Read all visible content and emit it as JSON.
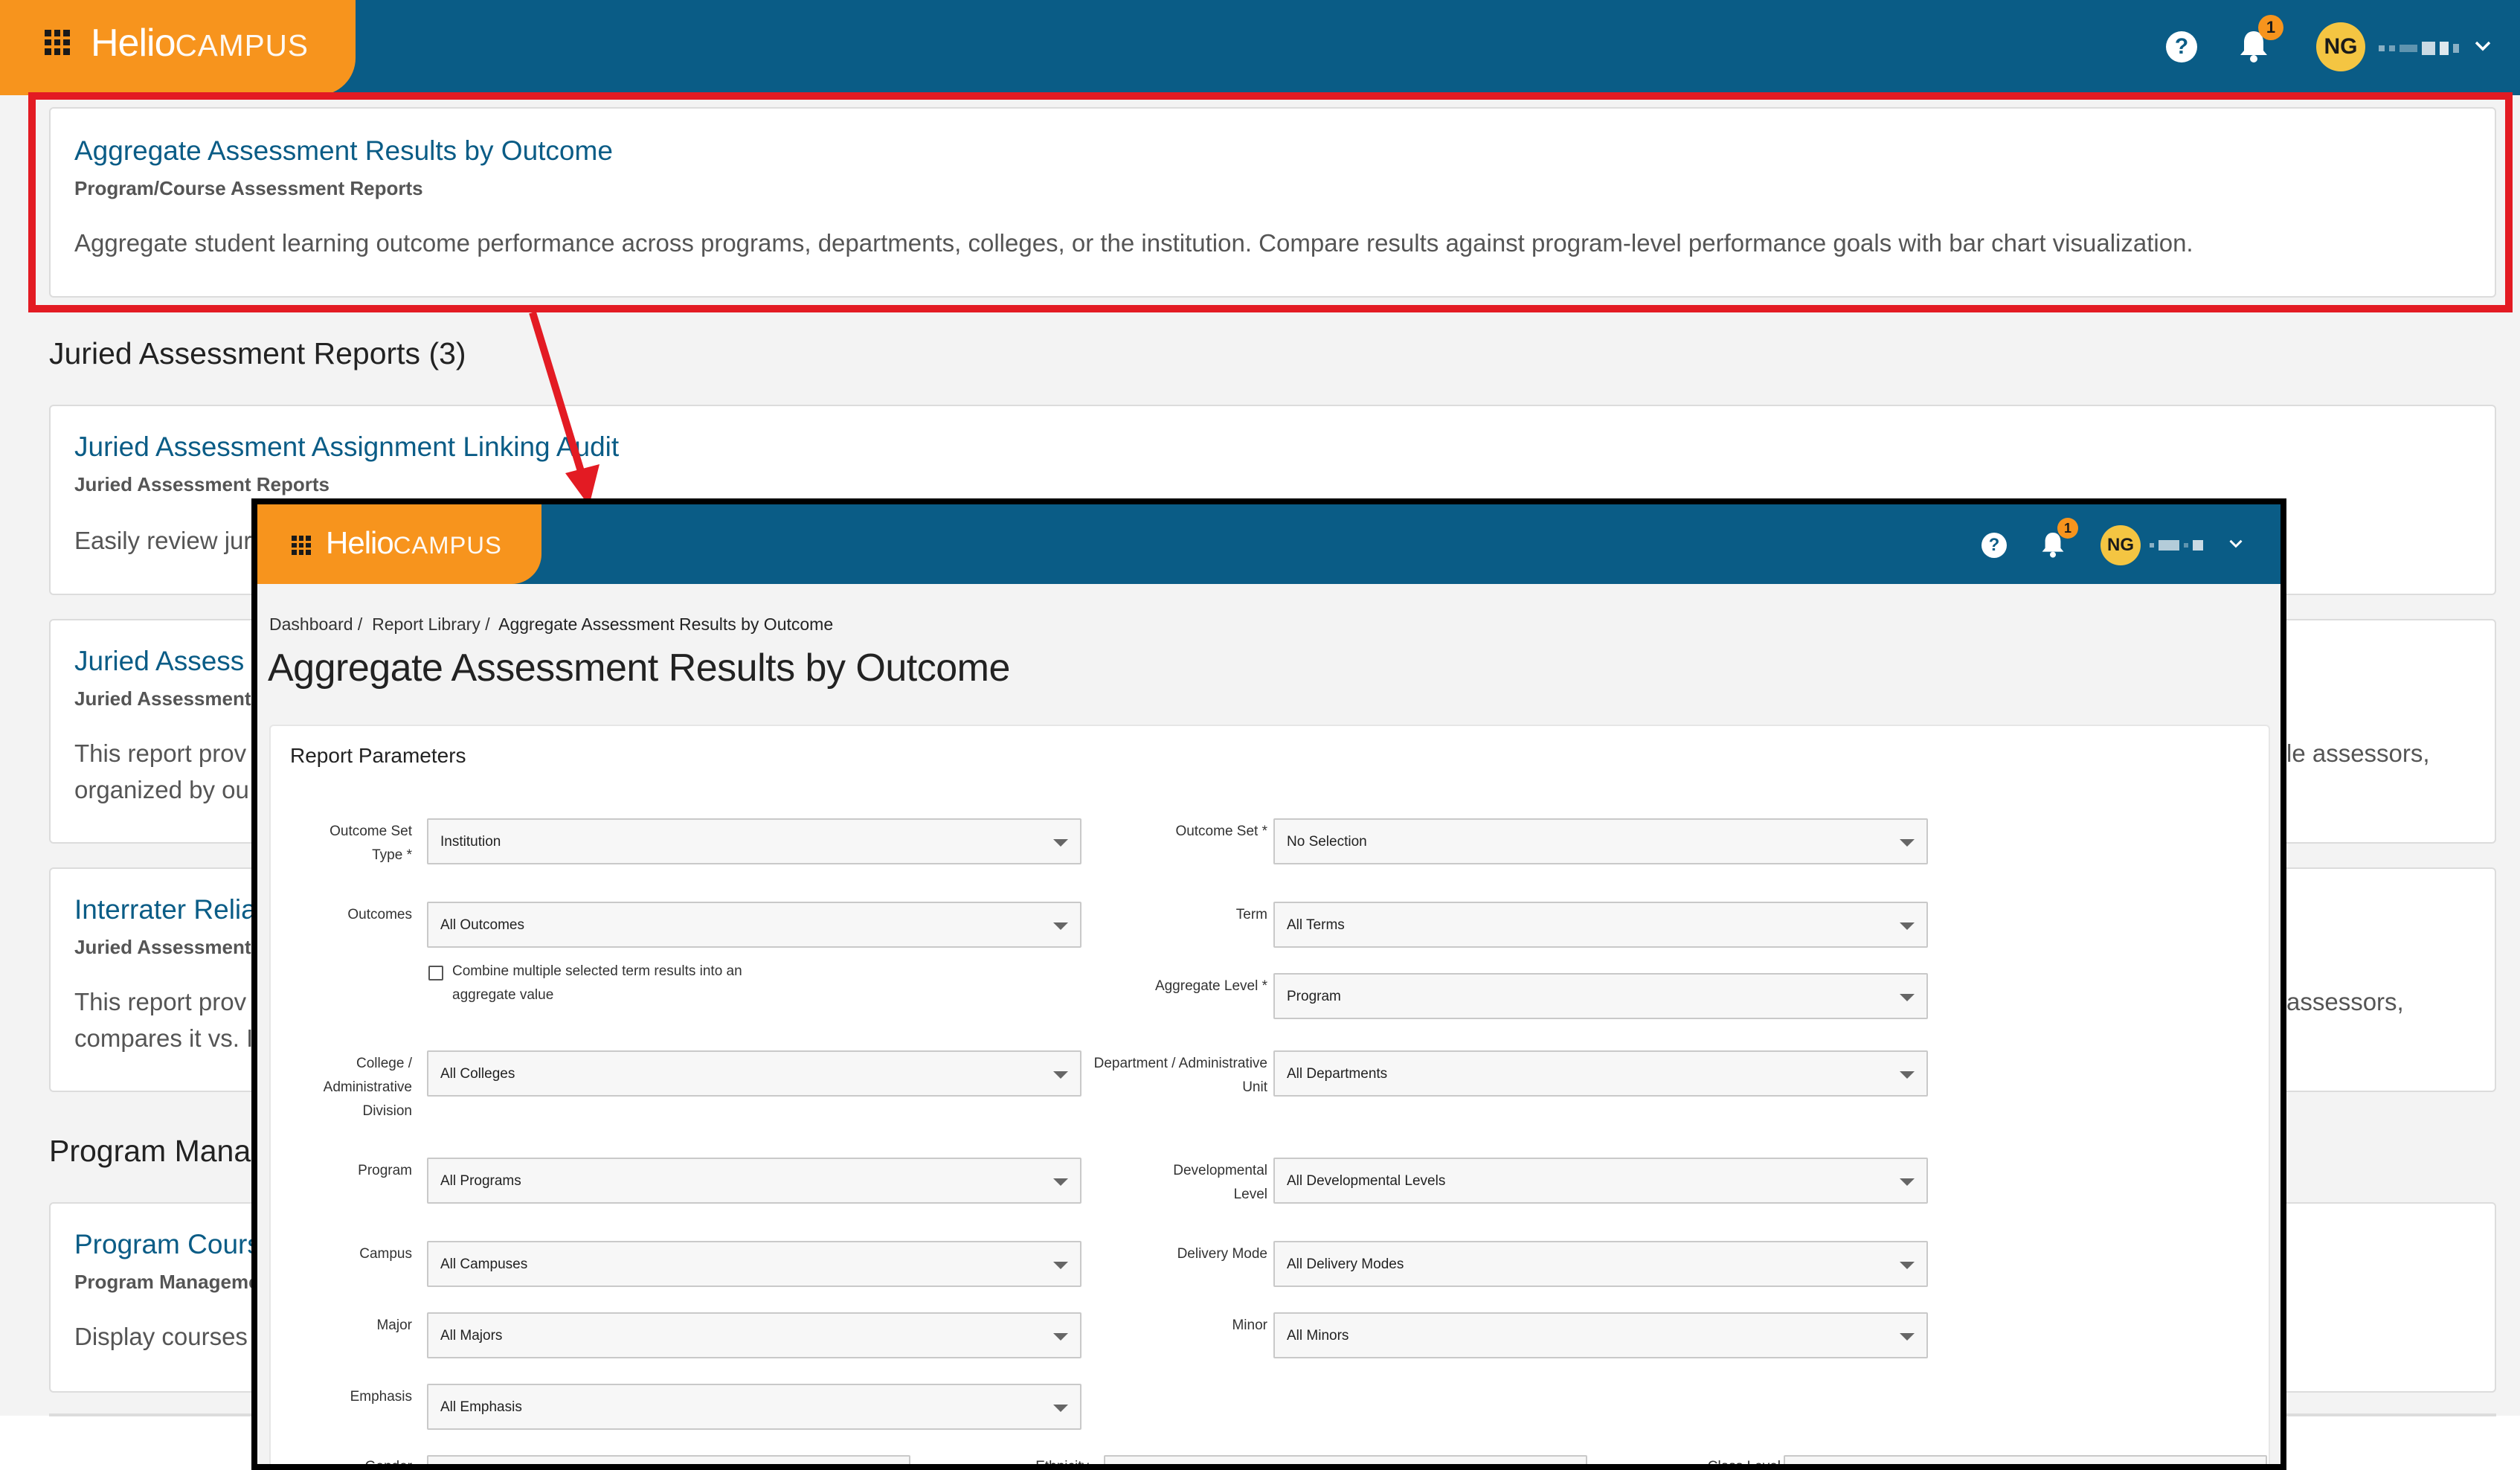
{
  "app": {
    "logo_main": "Helio",
    "logo_sub": "CAMPUS",
    "help_symbol": "?",
    "notification_count": "1",
    "avatar_initials": "NG"
  },
  "background": {
    "highlighted_card": {
      "title": "Aggregate Assessment Results by Outcome",
      "subtitle": "Program/Course Assessment Reports",
      "description": "Aggregate student learning outcome performance across programs, departments, colleges, or the institution. Compare results against program-level performance goals with bar chart visualization."
    },
    "section_juried": "Juried Assessment Reports (3)",
    "juried_cards": [
      {
        "title": "Juried Assessment Assignment Linking Audit",
        "subtitle": "Juried Assessment Reports",
        "desc_left": "Easily review jur",
        "desc_left2": "",
        "desc_right": "",
        "desc_right2": ""
      },
      {
        "title": "Juried Assess",
        "subtitle": "Juried Assessment R",
        "desc_left": "This report prov",
        "desc_left2": "organized by ou",
        "desc_right": "le assessors,",
        "desc_right2": ""
      },
      {
        "title": "Interrater Relia",
        "subtitle": "Juried Assessment R",
        "desc_left": "This report prov",
        "desc_left2": "compares it vs. I",
        "desc_right": "assessors,",
        "desc_right2": ""
      }
    ],
    "section_program": "Program Mana",
    "program_card": {
      "title": "Program Cours",
      "subtitle": "Program Manageme",
      "desc_left": "Display courses"
    }
  },
  "inset": {
    "breadcrumb": {
      "dashboard": "Dashboard /",
      "report_library": "Report Library /",
      "current": "Aggregate Assessment Results by Outcome"
    },
    "page_title": "Aggregate Assessment Results by Outcome",
    "panel_title": "Report Parameters",
    "fields": {
      "outcome_set_type_label": "Outcome Set Type *",
      "outcome_set_type_value": "Institution",
      "outcome_set_label": "Outcome Set *",
      "outcome_set_value": "No Selection",
      "outcomes_label": "Outcomes",
      "outcomes_value": "All Outcomes",
      "term_label": "Term",
      "term_value": "All Terms",
      "combine_label": "Combine multiple selected term results into an aggregate value",
      "combine_checked": false,
      "aggregate_level_label": "Aggregate Level *",
      "aggregate_level_value": "Program",
      "college_label": "College / Administrative Division",
      "college_value": "All Colleges",
      "department_label": "Department / Administrative Unit",
      "department_value": "All Departments",
      "program_label": "Program",
      "program_value": "All Programs",
      "developmental_level_label": "Developmental Level",
      "developmental_level_value": "All Developmental Levels",
      "campus_label": "Campus",
      "campus_value": "All Campuses",
      "delivery_mode_label": "Delivery Mode",
      "delivery_mode_value": "All Delivery Modes",
      "major_label": "Major",
      "major_value": "All Majors",
      "minor_label": "Minor",
      "minor_value": "All Minors",
      "emphasis_label": "Emphasis",
      "emphasis_value": "All Emphasis",
      "gender_label": "Gender",
      "ethnicity_label": "Ethnicity",
      "class_level_label": "Class Level"
    }
  },
  "colors": {
    "header_blue": "#0a5c86",
    "brand_orange": "#f7941d",
    "highlight_red": "#e31b23",
    "avatar_yellow": "#f4c542"
  }
}
